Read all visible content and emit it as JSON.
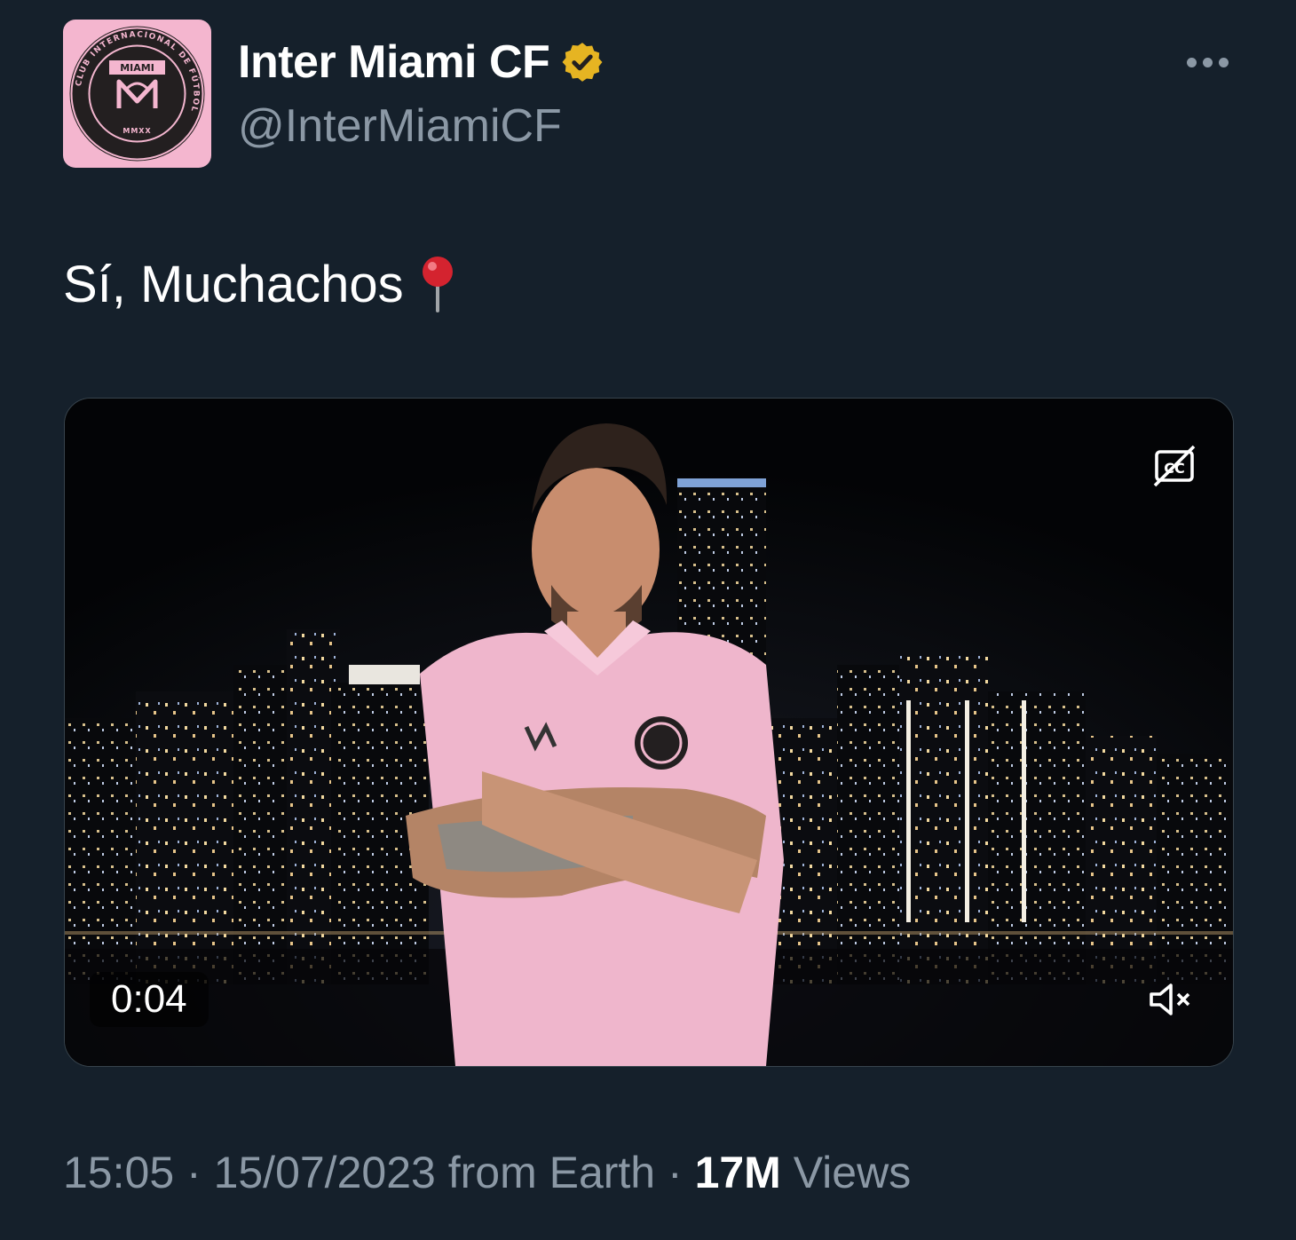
{
  "profile": {
    "display_name": "Inter Miami CF",
    "handle": "@InterMiamiCF",
    "verified_badge_color": "#e6b422",
    "avatar": {
      "background": "#f4b6cf",
      "ring_text": "CLUB INTERNACIONAL DE FÚTBOL",
      "banner": "MIAMI",
      "year": "MMXX"
    }
  },
  "tweet": {
    "text": "Sí, Muchachos",
    "emoji": "round-pushpin"
  },
  "video": {
    "elapsed": "0:04",
    "captions_icon": "captions-off-icon",
    "volume_icon": "muted-speaker-icon"
  },
  "meta": {
    "time": "15:05",
    "separator": " · ",
    "date": "15/07/2023",
    "source": "from Earth",
    "views_count": "17M",
    "views_label": "Views"
  },
  "colors": {
    "background": "#15202b",
    "secondary_text": "#8b98a5",
    "primary_text": "#ffffff",
    "jersey_pink": "#efb6cc"
  }
}
